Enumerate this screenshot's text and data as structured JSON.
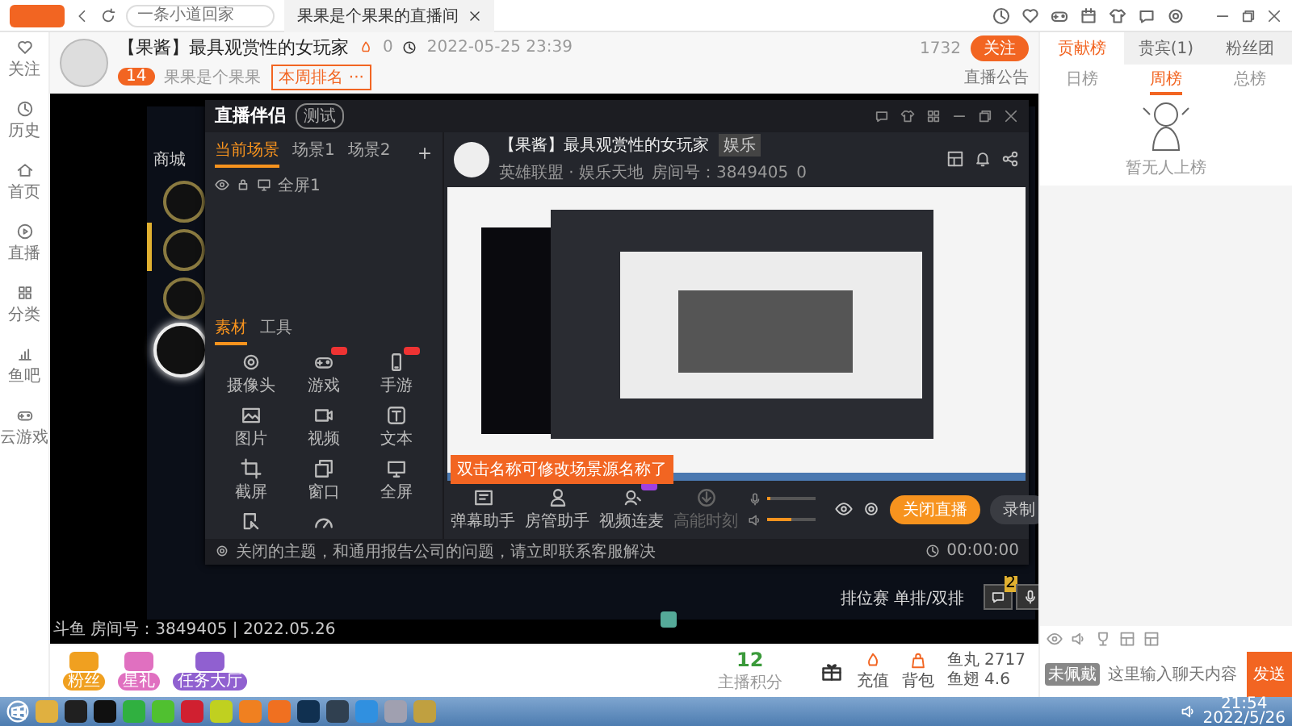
{
  "browser": {
    "tab_title": "果果是个果果的直播间",
    "search_placeholder": "一条小道回家"
  },
  "left_nav": [
    {
      "label": "关注",
      "selected": false
    },
    {
      "label": "历史",
      "selected": false
    },
    {
      "label": "首页",
      "selected": false
    },
    {
      "label": "直播",
      "selected": false
    },
    {
      "label": "分类",
      "selected": false
    },
    {
      "label": "鱼吧",
      "selected": false
    },
    {
      "label": "云游戏",
      "selected": false
    }
  ],
  "room": {
    "title": "【果酱】最具观赏性的女玩家",
    "heat": "0",
    "time": "2022-05-25 23:39",
    "level": "14",
    "anchor": "果果是个果果",
    "rank_tag": "本周排名 ···",
    "follow_count": "1732",
    "follow_button": "关注",
    "notice": "直播公告"
  },
  "video": {
    "watermark": "斗鱼 房间号：3849405 | 2022.05.26",
    "game_menu_title": "商城",
    "game_caption": "排位赛 单排/双排",
    "chat_badge": "2"
  },
  "streamer_app": {
    "name": "直播伴侣",
    "badge": "测试",
    "scene_tabs": [
      {
        "label": "当前场景",
        "selected": true
      },
      {
        "label": "场景1",
        "selected": false
      },
      {
        "label": "场景2",
        "selected": false
      }
    ],
    "source": "全屏1",
    "material_tabs": [
      {
        "label": "素材",
        "selected": true
      },
      {
        "label": "工具",
        "selected": false
      }
    ],
    "materials": [
      {
        "label": "摄像头",
        "hot": false
      },
      {
        "label": "游戏",
        "hot": true
      },
      {
        "label": "手游",
        "hot": true
      },
      {
        "label": "图片",
        "hot": false
      },
      {
        "label": "视频",
        "hot": false
      },
      {
        "label": "文本",
        "hot": false
      },
      {
        "label": "截屏",
        "hot": false
      },
      {
        "label": "窗口",
        "hot": false
      },
      {
        "label": "全屏",
        "hot": false
      }
    ],
    "tooltip": "双击名称可修改场景源名称了",
    "room_title": "【果酱】最具观赏性的女玩家",
    "room_tag": "娱乐",
    "category": "英雄联盟 · 娱乐天地",
    "room_id": "房间号：3849405",
    "likes": "0",
    "tools": [
      {
        "label": "弹幕助手",
        "new": false,
        "disabled": false
      },
      {
        "label": "房管助手",
        "new": false,
        "disabled": false
      },
      {
        "label": "视频连麦",
        "new": true,
        "disabled": false
      },
      {
        "label": "高能时刻",
        "new": false,
        "disabled": true
      }
    ],
    "mic": {
      "level": 0.05
    },
    "speaker": {
      "level": 0.5
    },
    "stop_button": "关闭直播",
    "record_button": "录制",
    "footer_notice": "关闭的主题，和通用报告公司的问题，请立即联系客服解决",
    "timer": "00:00:00"
  },
  "bottom_bar": {
    "gifts": [
      {
        "label": "粉丝",
        "color": "#f0a020"
      },
      {
        "label": "星礼",
        "color": "#e070c0"
      },
      {
        "label": "任务大厅",
        "color": "#9060d0"
      }
    ],
    "points": "12",
    "points_label": "主播积分",
    "actions": [
      {
        "label": "充值"
      },
      {
        "label": "背包"
      }
    ],
    "wallet": [
      {
        "label": "鱼丸",
        "value": "2717"
      },
      {
        "label": "鱼翅",
        "value": "4.6"
      }
    ]
  },
  "sidebar": {
    "tabs": [
      {
        "label": "贡献榜",
        "selected": true
      },
      {
        "label": "贵宾(1)",
        "selected": false
      },
      {
        "label": "粉丝团",
        "selected": false
      }
    ],
    "subtabs": [
      {
        "label": "日榜",
        "selected": false
      },
      {
        "label": "周榜",
        "selected": true
      },
      {
        "label": "总榜",
        "selected": false
      }
    ],
    "empty_text": "暂无人上榜",
    "badge": "未佩戴",
    "chat_placeholder": "这里输入聊天内容",
    "send_button": "发送"
  },
  "taskbar": {
    "apps": [
      {
        "color": "#e0b040"
      },
      {
        "color": "#202020"
      },
      {
        "color": "#101010"
      },
      {
        "color": "#30b040"
      },
      {
        "color": "#50c030"
      },
      {
        "color": "#d02030"
      },
      {
        "color": "#c0d020"
      },
      {
        "color": "#f08020"
      },
      {
        "color": "#f07020"
      },
      {
        "color": "#103050"
      },
      {
        "color": "#304050"
      },
      {
        "color": "#3090e0"
      },
      {
        "color": "#a0a0b0"
      },
      {
        "color": "#c0a040"
      }
    ],
    "time": "21:54",
    "date": "2022/5/26"
  }
}
